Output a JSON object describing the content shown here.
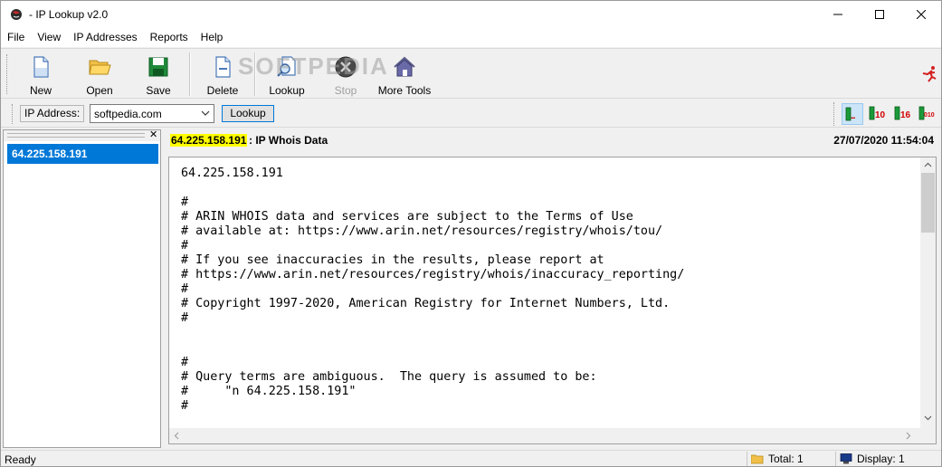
{
  "window": {
    "title": "- IP Lookup v2.0",
    "app_icon": "globe-icon",
    "controls": [
      "minimize-icon",
      "maximize-icon",
      "close-icon"
    ]
  },
  "menu": [
    "File",
    "View",
    "IP Addresses",
    "Reports",
    "Help"
  ],
  "toolbar": {
    "new_label": "New",
    "open_label": "Open",
    "save_label": "Save",
    "delete_label": "Delete",
    "lookup_label": "Lookup",
    "stop_label": "Stop",
    "more_tools_label": "More Tools",
    "watermark": "SOFTPEDIA",
    "stop_disabled": true
  },
  "addressbar": {
    "label": "IP Address:",
    "value": "softpedia.com",
    "lookup_button": "Lookup",
    "view_buttons": [
      "...",
      "10",
      "16",
      "010"
    ]
  },
  "left_list": {
    "items": [
      "64.225.158.191"
    ],
    "selected": 0
  },
  "result": {
    "ip": "64.225.158.191",
    "title": ": IP Whois Data",
    "timestamp": "27/07/2020 11:54:04",
    "lines": [
      "64.225.158.191",
      "",
      "#",
      "# ARIN WHOIS data and services are subject to the Terms of Use",
      "# available at: https://www.arin.net/resources/registry/whois/tou/",
      "#",
      "# If you see inaccuracies in the results, please report at",
      "# https://www.arin.net/resources/registry/whois/inaccuracy_reporting/",
      "#",
      "# Copyright 1997-2020, American Registry for Internet Numbers, Ltd.",
      "#",
      "",
      "",
      "#",
      "# Query terms are ambiguous.  The query is assumed to be:",
      "#     \"n 64.225.158.191\"",
      "#"
    ]
  },
  "status": {
    "ready": "Ready",
    "total": "Total: 1",
    "display": "Display: 1"
  },
  "colors": {
    "selection": "#0078d7",
    "highlight": "#ffff00",
    "accent": "#0078d7"
  }
}
